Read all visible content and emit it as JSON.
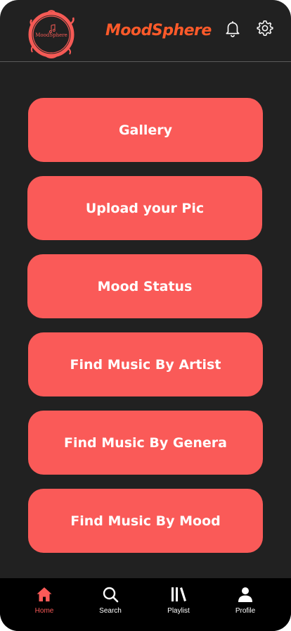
{
  "header": {
    "logo_text": "MoodSphere",
    "title": "MoodSphere"
  },
  "menu": [
    {
      "label": "Gallery"
    },
    {
      "label": "Upload your Pic"
    },
    {
      "label": "Mood Status"
    },
    {
      "label": "Find Music By Artist"
    },
    {
      "label": "Find Music By Genera"
    },
    {
      "label": "Find Music By Mood"
    }
  ],
  "nav": [
    {
      "label": "Home",
      "icon": "home-icon",
      "active": true
    },
    {
      "label": "Search",
      "icon": "search-icon",
      "active": false
    },
    {
      "label": "Playlist",
      "icon": "library-icon",
      "active": false
    },
    {
      "label": "Profile",
      "icon": "profile-icon",
      "active": false
    }
  ],
  "colors": {
    "background": "#212121",
    "accent": "#fa5a58",
    "title": "#ff5a2a",
    "nav_background": "#000000"
  }
}
